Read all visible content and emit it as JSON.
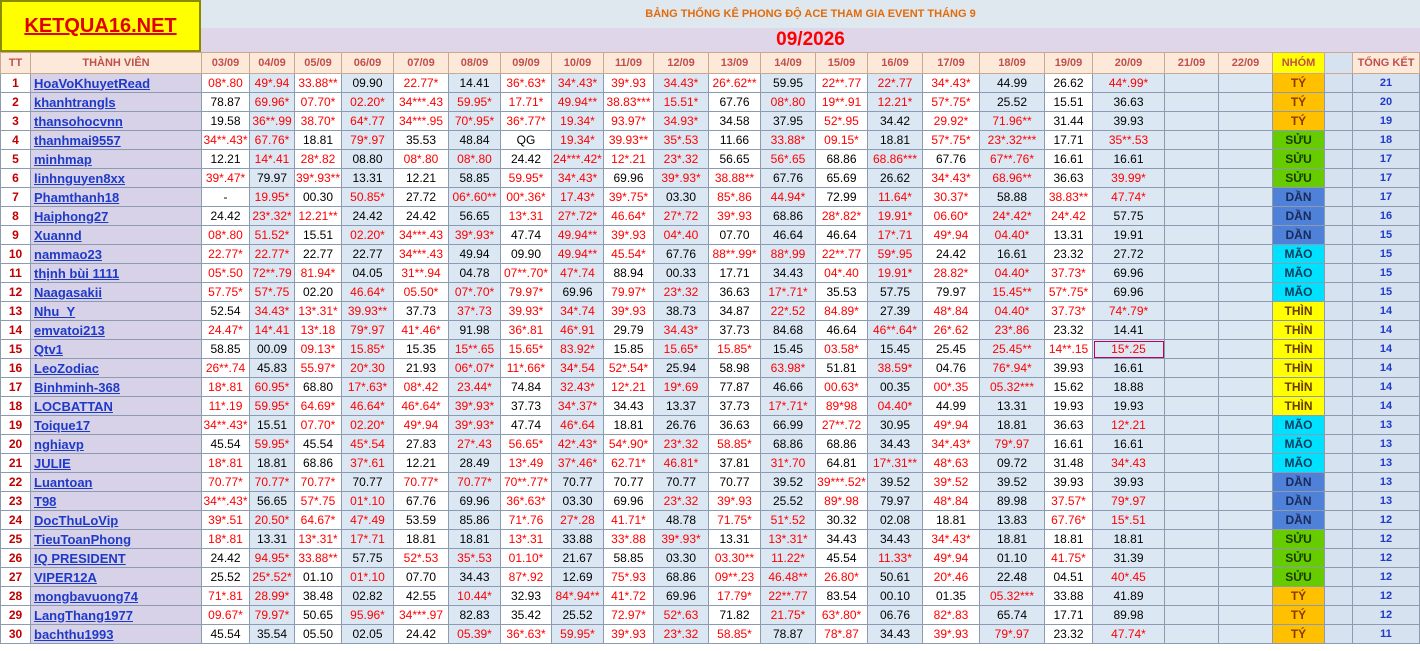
{
  "logo": "KETQUA16.NET",
  "title": "BẢNG THỐNG KÊ PHONG ĐỘ ACE THAM GIA EVENT THÁNG 9",
  "month": "09/2026",
  "headers": {
    "tt": "TT",
    "member": "THÀNH VIÊN",
    "dates": [
      "03/09",
      "04/09",
      "05/09",
      "06/09",
      "07/09",
      "08/09",
      "09/09",
      "10/09",
      "11/09",
      "12/09",
      "13/09",
      "14/09",
      "15/09",
      "16/09",
      "17/09",
      "18/09",
      "19/09",
      "20/09",
      "21/09",
      "22/09"
    ],
    "group": "NHÓM",
    "total": "TỔNG KẾT"
  },
  "group_colors": {
    "TÝ": "#ffc000",
    "SỬU": "#66cc00",
    "DẦN": "#4f81d9",
    "MÃO": "#00e0ff",
    "THÌN": "#ffff00"
  },
  "rows": [
    {
      "tt": "1",
      "name": "HoaVoKhuyetRead",
      "cells": [
        "08*.80",
        "49*.94",
        "33.88**",
        "09.90",
        "22.77*",
        "14.41",
        "36*.63*",
        "34*.43*",
        "39*.93",
        "34.43*",
        "26*.62**",
        "59.95",
        "22**.77",
        "22*.77",
        "34*.43*",
        "44.99",
        "26.62",
        "44*.99*"
      ],
      "group": "TÝ",
      "total": "21"
    },
    {
      "tt": "2",
      "name": "khanhtrangls",
      "cells": [
        "78.87",
        "69.96*",
        "07.70*",
        "02.20*",
        "34***.43",
        "59.95*",
        "17.71*",
        "49.94**",
        "38.83***",
        "15.51*",
        "67.76",
        "08*.80",
        "19**.91",
        "12.21*",
        "57*.75*",
        "25.52",
        "15.51",
        "36.63"
      ],
      "group": "TÝ",
      "total": "20"
    },
    {
      "tt": "3",
      "name": "thansohocvnn",
      "cells": [
        "19.58",
        "36**.99",
        "38.70*",
        "64*.77",
        "34***.95",
        "70*.95*",
        "36*.77*",
        "19.34*",
        "93.97*",
        "34.93*",
        "34.58",
        "37.95",
        "52*.95",
        "34.42",
        "29.92*",
        "71.96**",
        "31.44",
        "39.93"
      ],
      "group": "TÝ",
      "total": "19"
    },
    {
      "tt": "4",
      "name": "thanhmai9557",
      "cells": [
        "34**.43*",
        "67.76*",
        "18.81",
        "79*.97",
        "35.53",
        "48.84",
        "QG",
        "19.34*",
        "39.93**",
        "35*.53",
        "11.66",
        "33.88*",
        "09.15*",
        "18.81",
        "57*.75*",
        "23*.32***",
        "17.71",
        "35**.53"
      ],
      "group": "SỬU",
      "total": "18"
    },
    {
      "tt": "5",
      "name": "minhmap",
      "cells": [
        "12.21",
        "14*.41",
        "28*.82",
        "08.80",
        "08*.80",
        "08*.80",
        "24.42",
        "24***.42*",
        "12*.21",
        "23*.32",
        "56.65",
        "56*.65",
        "68.86",
        "68.86***",
        "67.76",
        "67**.76*",
        "16.61",
        "16.61"
      ],
      "group": "SỬU",
      "total": "17"
    },
    {
      "tt": "6",
      "name": "linhnguyen8xx",
      "cells": [
        "39*.47*",
        "79.97",
        "39*.93**",
        "13.31",
        "12.21",
        "58.85",
        "59.95*",
        "34*.43*",
        "69.96",
        "39*.93*",
        "38.88**",
        "67.76",
        "65.69",
        "26.62",
        "34*.43*",
        "68.96**",
        "36.63",
        "39.99*"
      ],
      "group": "SỬU",
      "total": "17"
    },
    {
      "tt": "7",
      "name": "Phamthanh18",
      "cells": [
        "-",
        "19.95*",
        "00.30",
        "50.85*",
        "27.72",
        "06*.60**",
        "00*.36*",
        "17.43*",
        "39*.75*",
        "03.30",
        "85*.86",
        "44.94*",
        "72.99",
        "11.64*",
        "30.37*",
        "58.88",
        "38.83**",
        "47.74*"
      ],
      "group": "DẦN",
      "total": "17"
    },
    {
      "tt": "8",
      "name": "Haiphong27",
      "cells": [
        "24.42",
        "23*.32*",
        "12.21**",
        "24.42",
        "24.42",
        "56.65",
        "13*.31",
        "27*.72*",
        "46.64*",
        "27*.72",
        "39*.93",
        "68.86",
        "28*.82*",
        "19.91*",
        "06.60*",
        "24*.42*",
        "24*.42",
        "57.75"
      ],
      "group": "DẦN",
      "total": "16"
    },
    {
      "tt": "9",
      "name": "Xuannd",
      "cells": [
        "08*.80",
        "51.52*",
        "15.51",
        "02.20*",
        "34***.43",
        "39*.93*",
        "47.74",
        "49.94**",
        "39*.93",
        "04*.40",
        "07.70",
        "46.64",
        "46.64",
        "17*.71",
        "49*.94",
        "04.40*",
        "13.31",
        "19.91"
      ],
      "group": "DẦN",
      "total": "15"
    },
    {
      "tt": "10",
      "name": "nammao23",
      "cells": [
        "22.77*",
        "22.77*",
        "22.77",
        "22.77",
        "34***.43",
        "49.94",
        "09.90",
        "49.94**",
        "45.54*",
        "67.76",
        "88**.99*",
        "88*.99",
        "22**.77",
        "59*.95",
        "24.42",
        "16.61",
        "23.32",
        "27.72"
      ],
      "group": "MÃO",
      "total": "15"
    },
    {
      "tt": "11",
      "name": "thịnh bùi 1111",
      "cells": [
        "05*.50",
        "72**.79",
        "81.94*",
        "04.05",
        "31**.94",
        "04.78",
        "07**.70*",
        "47*.74",
        "88.94",
        "00.33",
        "17.71",
        "34.43",
        "04*.40",
        "19.91*",
        "28.82*",
        "04.40*",
        "37.73*",
        "69.96"
      ],
      "group": "MÃO",
      "total": "15"
    },
    {
      "tt": "12",
      "name": "Naagasakii",
      "cells": [
        "57.75*",
        "57*.75",
        "02.20",
        "46.64*",
        "05.50*",
        "07*.70*",
        "79.97*",
        "69.96",
        "79.97*",
        "23*.32",
        "36.63",
        "17*.71*",
        "35.53",
        "57.75",
        "79.97",
        "15.45**",
        "57*.75*",
        "69.96"
      ],
      "group": "MÃO",
      "total": "15"
    },
    {
      "tt": "13",
      "name": "Nhu_Y",
      "cells": [
        "52.54",
        "34.43*",
        "13*.31*",
        "39.93**",
        "37.73",
        "37*.73",
        "39.93*",
        "34*.74",
        "39*.93",
        "38.73",
        "34.87",
        "22*.52",
        "84.89*",
        "27.39",
        "48*.84",
        "04.40*",
        "37.73*",
        "74*.79*"
      ],
      "group": "THÌN",
      "total": "14"
    },
    {
      "tt": "14",
      "name": "emvatoi213",
      "cells": [
        "24.47*",
        "14*.41",
        "13*.18",
        "79*.97",
        "41*.46*",
        "91.98",
        "36*.81",
        "46*.91",
        "29.79",
        "34.43*",
        "37.73",
        "84.68",
        "46.64",
        "46**.64*",
        "26*.62",
        "23*.86",
        "23.32",
        "14.41"
      ],
      "group": "THÌN",
      "total": "14"
    },
    {
      "tt": "15",
      "name": "Qtv1",
      "cells": [
        "58.85",
        "00.09",
        "09.13*",
        "15.85*",
        "15.35",
        "15**.65",
        "15.65*",
        "83.92*",
        "15.85",
        "15.65*",
        "15.85*",
        "15.45",
        "03.58*",
        "15.45",
        "25.45",
        "25.45**",
        "14**.15",
        "15*.25"
      ],
      "group": "THÌN",
      "total": "14"
    },
    {
      "tt": "16",
      "name": "LeoZodiac",
      "cells": [
        "26**.74",
        "45.83",
        "55.97*",
        "20*.30",
        "21.93",
        "06*.07*",
        "11*.66*",
        "34*.54",
        "52*.54*",
        "25.94",
        "58.98",
        "63.98*",
        "51.81",
        "38.59*",
        "04.76",
        "76*.94*",
        "39.93",
        "16.61"
      ],
      "group": "THÌN",
      "total": "14"
    },
    {
      "tt": "17",
      "name": "Binhminh-368",
      "cells": [
        "18*.81",
        "60.95*",
        "68.80",
        "17*.63*",
        "08*.42",
        "23.44*",
        "74.84",
        "32.43*",
        "12*.21",
        "19*.69",
        "77.87",
        "46.66",
        "00.63*",
        "00.35",
        "00*.35",
        "05.32***",
        "15.62",
        "18.88"
      ],
      "group": "THÌN",
      "total": "14"
    },
    {
      "tt": "18",
      "name": "LOCBATTAN",
      "cells": [
        "11*.19",
        "59.95*",
        "64.69*",
        "46.64*",
        "46*.64*",
        "39*.93*",
        "37.73",
        "34*.37*",
        "34.43",
        "13.37",
        "37.73",
        "17*.71*",
        "89*98",
        "04.40*",
        "44.99",
        "13.31",
        "19.93",
        "19.93"
      ],
      "group": "THÌN",
      "total": "14"
    },
    {
      "tt": "19",
      "name": "Toique17",
      "cells": [
        "34**.43*",
        "15.51",
        "07.70*",
        "02.20*",
        "49*.94",
        "39*.93*",
        "47.74",
        "46*.64",
        "18.81",
        "26.76",
        "36.63",
        "66.99",
        "27**.72",
        "30.95",
        "49*.94",
        "18.81",
        "36.63",
        "12*.21"
      ],
      "group": "MÃO",
      "total": "13"
    },
    {
      "tt": "20",
      "name": "nghiavp",
      "cells": [
        "45.54",
        "59.95*",
        "45.54",
        "45*.54",
        "27.83",
        "27*.43",
        "56.65*",
        "42*.43*",
        "54*.90*",
        "23*.32",
        "58.85*",
        "68.86",
        "68.86",
        "34.43",
        "34*.43*",
        "79*.97",
        "16.61",
        "16.61"
      ],
      "group": "MÃO",
      "total": "13"
    },
    {
      "tt": "21",
      "name": "JULIE",
      "cells": [
        "18*.81",
        "18.81",
        "68.86",
        "37*.61",
        "12.21",
        "28.49",
        "13*.49",
        "37*.46*",
        "62.71*",
        "46.81*",
        "37.81",
        "31*.70",
        "64.81",
        "17*.31**",
        "48*.63",
        "09.72",
        "31.48",
        "34*.43"
      ],
      "group": "MÃO",
      "total": "13"
    },
    {
      "tt": "22",
      "name": "Luantoan",
      "cells": [
        "70.77*",
        "70.77*",
        "70.77*",
        "70.77",
        "70.77*",
        "70.77*",
        "70**.77*",
        "70.77",
        "70.77",
        "70.77",
        "70.77",
        "39.52",
        "39***.52*",
        "39.52",
        "39*.52",
        "39.52",
        "39.93",
        "39.93"
      ],
      "group": "DẦN",
      "total": "13"
    },
    {
      "tt": "23",
      "name": "T98",
      "cells": [
        "34**.43*",
        "56.65",
        "57*.75",
        "01*.10",
        "67.76",
        "69.96",
        "36*.63*",
        "03.30",
        "69.96",
        "23*.32",
        "39*.93",
        "25.52",
        "89*.98",
        "79.97",
        "48*.84",
        "89.98",
        "37.57*",
        "79*.97"
      ],
      "group": "DẦN",
      "total": "13"
    },
    {
      "tt": "24",
      "name": "DocThuLoVip",
      "cells": [
        "39*.51",
        "20.50*",
        "64.67*",
        "47*.49",
        "53.59",
        "85.86",
        "71*.76",
        "27*.28",
        "41.71*",
        "48.78",
        "71.75*",
        "51*.52",
        "30.32",
        "02.08",
        "18.81",
        "13.83",
        "67.76*",
        "15*.51"
      ],
      "group": "DẦN",
      "total": "12"
    },
    {
      "tt": "25",
      "name": "TieuToanPhong",
      "cells": [
        "18*.81",
        "13.31",
        "13*.31*",
        "17*.71",
        "18.81",
        "18.81",
        "13*.31",
        "33.88",
        "33*.88",
        "39*.93*",
        "13.31",
        "13*.31*",
        "34.43",
        "34.43",
        "34*.43*",
        "18.81",
        "18.81",
        "18.81"
      ],
      "group": "SỬU",
      "total": "12"
    },
    {
      "tt": "26",
      "name": "IQ PRESIDENT",
      "cells": [
        "24.42",
        "94.95*",
        "33.88**",
        "57.75",
        "52*.53",
        "35*.53",
        "01.10*",
        "21.67",
        "58.85",
        "03.30",
        "03.30**",
        "11.22*",
        "45.54",
        "11.33*",
        "49*.94",
        "01.10",
        "41.75*",
        "31.39"
      ],
      "group": "SỬU",
      "total": "12"
    },
    {
      "tt": "27",
      "name": "VIPER12A",
      "cells": [
        "25.52",
        "25*.52*",
        "01.10",
        "01*.10",
        "07.70",
        "34.43",
        "87*.92",
        "12.69",
        "75*.93",
        "68.86",
        "09**.23",
        "46.48**",
        "26.80*",
        "50.61",
        "20*.46",
        "22.48",
        "04.51",
        "40*.45"
      ],
      "group": "SỬU",
      "total": "12"
    },
    {
      "tt": "28",
      "name": "mongbavuong74",
      "cells": [
        "71*.81",
        "28.99*",
        "38.48",
        "02.82",
        "42.55",
        "10.44*",
        "32.93",
        "84*.94**",
        "41*.72",
        "69.96",
        "17.79*",
        "22**.77",
        "83.54",
        "00.10",
        "01.35",
        "05.32***",
        "33.88",
        "41.89"
      ],
      "group": "TÝ",
      "total": "12"
    },
    {
      "tt": "29",
      "name": "LangThang1977",
      "cells": [
        "09.67*",
        "79.97*",
        "50.65",
        "95.96*",
        "34***.97",
        "82.83",
        "35.42",
        "25.52",
        "72.97*",
        "52*.63",
        "71.82",
        "21.75*",
        "63*.80*",
        "06.76",
        "82*.83",
        "65.74",
        "17.71",
        "89.98"
      ],
      "group": "TÝ",
      "total": "12"
    },
    {
      "tt": "30",
      "name": "bachthu1993",
      "cells": [
        "45.54",
        "35.54",
        "05.50",
        "02.05",
        "24.42",
        "05.39*",
        "36*.63*",
        "59.95*",
        "39*.93",
        "23*.32",
        "58.85*",
        "78.87",
        "78*.87",
        "34.43",
        "39*.93",
        "79*.97",
        "23.32",
        "47.74*"
      ],
      "group": "TÝ",
      "total": "11"
    }
  ]
}
